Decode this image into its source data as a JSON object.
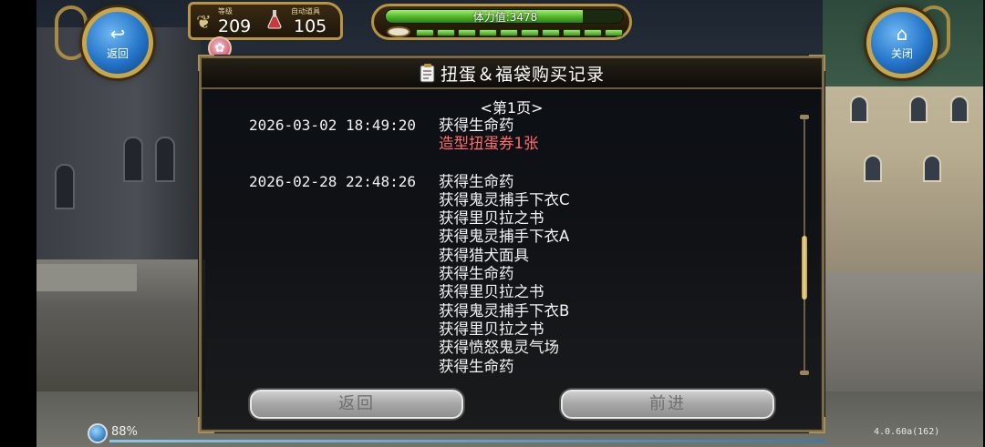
{
  "hud": {
    "back_label": "返回",
    "back_glyph": "↩",
    "close_label": "关闭",
    "close_glyph": "⌂",
    "level_label": "等级",
    "level_value": "209",
    "auto_item_label": "自动道具",
    "auto_item_value": "105",
    "stamina_text": "体力值:3478",
    "stamina_fill_fraction": 0.83,
    "stamina_segments": 10,
    "gift_glyph": "✿"
  },
  "panel": {
    "title": "扭蛋＆福袋购买记录",
    "page_indicator": "<第1页>",
    "scroll_fraction": 0.62,
    "entries": [
      {
        "timestamp": "2026-03-02 18:49:20",
        "items": [
          {
            "text": "获得生命药",
            "highlight": false
          },
          {
            "text": "造型扭蛋券1张",
            "highlight": true
          }
        ]
      },
      {
        "timestamp": "2026-02-28 22:48:26",
        "items": [
          {
            "text": "获得生命药",
            "highlight": false
          },
          {
            "text": "获得鬼灵捕手下衣C",
            "highlight": false
          },
          {
            "text": "获得里贝拉之书",
            "highlight": false
          },
          {
            "text": "获得鬼灵捕手下衣A",
            "highlight": false
          },
          {
            "text": "获得猎犬面具",
            "highlight": false
          },
          {
            "text": "获得生命药",
            "highlight": false
          },
          {
            "text": "获得里贝拉之书",
            "highlight": false
          },
          {
            "text": "获得鬼灵捕手下衣B",
            "highlight": false
          },
          {
            "text": "获得里贝拉之书",
            "highlight": false
          },
          {
            "text": "获得愤怒鬼灵气场",
            "highlight": false
          },
          {
            "text": "获得生命药",
            "highlight": false
          }
        ]
      }
    ],
    "prev_button": "返回",
    "next_button": "前进"
  },
  "status": {
    "battery": "88%",
    "version": "4.0.60a(162)"
  },
  "colors": {
    "highlight_red": "#ff6b6b",
    "frame_gold": "#b99442",
    "stamina_green": "#4fb52a"
  }
}
